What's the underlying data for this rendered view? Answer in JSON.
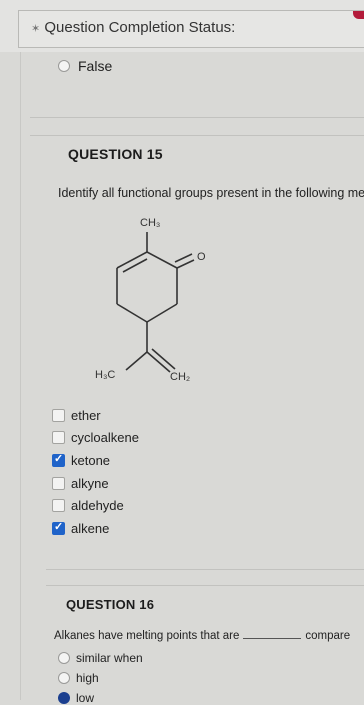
{
  "status_bar": {
    "title": "Question Completion Status:"
  },
  "previous_question": {
    "option_false": "False"
  },
  "question15": {
    "heading": "QUESTION 15",
    "prompt": "Identify all functional groups present in the following me",
    "molecule_labels": {
      "top_methyl": "CH₃",
      "left_methyl": "H₃C",
      "methylene": "CH₂",
      "oxygen": "O"
    },
    "choices": [
      {
        "label": "ether",
        "checked": false
      },
      {
        "label": "cycloalkene",
        "checked": false
      },
      {
        "label": "ketone",
        "checked": true
      },
      {
        "label": "alkyne",
        "checked": false
      },
      {
        "label": "aldehyde",
        "checked": false
      },
      {
        "label": "alkene",
        "checked": true
      }
    ]
  },
  "question16": {
    "heading": "QUESTION 16",
    "prompt_before": "Alkanes have melting points that are",
    "prompt_after": "compare",
    "options": [
      "similar when",
      "high",
      "low"
    ]
  },
  "colors": {
    "checkbox_checked": "#1f63c9",
    "accent_red": "#b31b3a"
  }
}
